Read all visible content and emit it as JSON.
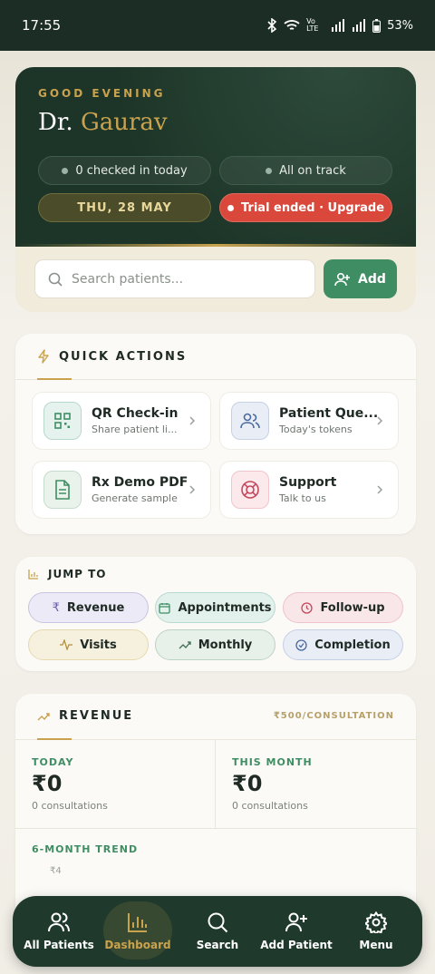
{
  "status_bar": {
    "time": "17:55",
    "network_label": "Vo LTE",
    "battery": "53%"
  },
  "hero": {
    "greeting": "GOOD EVENING",
    "prefix": "Dr.",
    "name": "Gaurav",
    "checked_in": "0 checked in today",
    "on_track": "All on track",
    "date": "THU, 28 MAY",
    "trial": "Trial ended · Upgrade"
  },
  "search": {
    "placeholder": "Search patients...",
    "add_label": "Add"
  },
  "quick_actions": {
    "title": "QUICK ACTIONS",
    "items": [
      {
        "title": "QR Check-in",
        "subtitle": "Share patient li..."
      },
      {
        "title": "Patient Que...",
        "subtitle": "Today's tokens"
      },
      {
        "title": "Rx Demo PDF",
        "subtitle": "Generate sample"
      },
      {
        "title": "Support",
        "subtitle": "Talk to us"
      }
    ]
  },
  "jump_to": {
    "title": "JUMP TO",
    "chips": [
      "Revenue",
      "Appointments",
      "Follow-up",
      "Visits",
      "Monthly",
      "Completion"
    ]
  },
  "revenue": {
    "title": "REVENUE",
    "rate": "₹500/CONSULTATION",
    "today_label": "TODAY",
    "today_value": "₹0",
    "today_sub": "0 consultations",
    "month_label": "THIS MONTH",
    "month_value": "₹0",
    "month_sub": "0 consultations",
    "trend_label": "6-MONTH TREND",
    "axis_tick": "₹4"
  },
  "nav": {
    "items": [
      "All Patients",
      "Dashboard",
      "Search",
      "Add Patient",
      "Menu"
    ],
    "active": "Dashboard"
  },
  "colors": {
    "forest": "#1d3528",
    "gold": "#c9a24e",
    "green": "#3f8e63",
    "danger": "#d9483b"
  }
}
